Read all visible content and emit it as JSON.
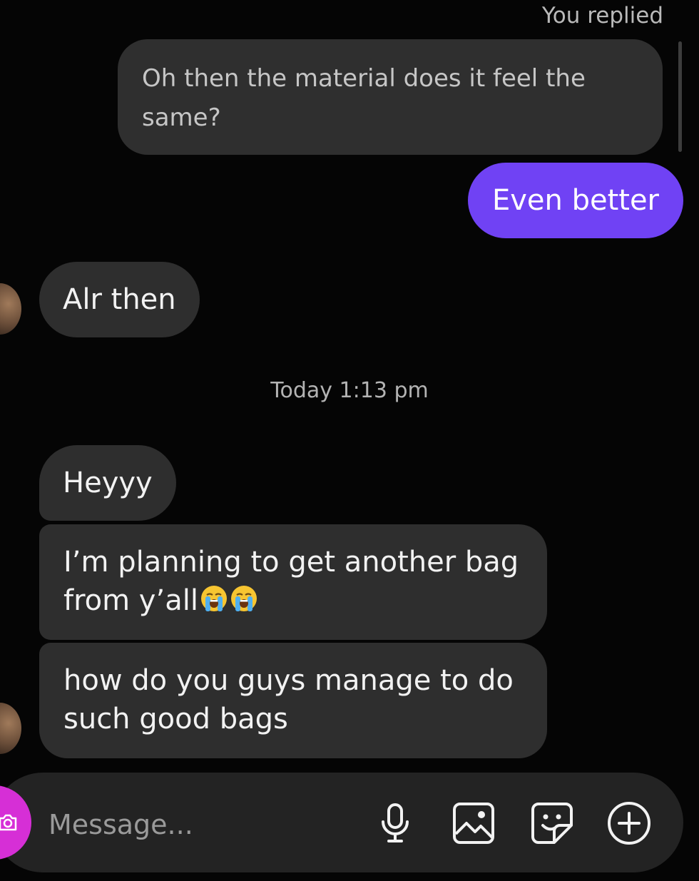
{
  "thread": {
    "reply_label": "You replied",
    "quoted_message": "Oh then the material does it feel the same?",
    "sent_message": "Even better",
    "received_1": "Alr then",
    "timestamp": "Today 1:13 pm",
    "received_2": "Heyyy",
    "received_3": "I’m planning to get another bag from y’all",
    "received_3_emojis": [
      "loudly-crying-face",
      "loudly-crying-face"
    ],
    "received_4": "how do you guys manage to do such good bags"
  },
  "composer": {
    "placeholder": "Message..."
  },
  "colors": {
    "background": "#050505",
    "sent_bubble": "#7042f4",
    "received_bubble": "#2e2e2e",
    "camera_button": "#d62fd6"
  },
  "icons": [
    "camera-icon",
    "microphone-icon",
    "gallery-icon",
    "sticker-icon",
    "plus-icon"
  ]
}
